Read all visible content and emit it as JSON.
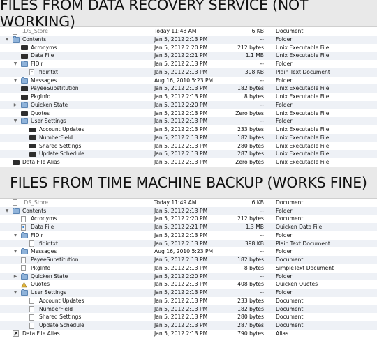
{
  "banners": {
    "top": "FILES FROM DATA RECOVERY SERVICE (NOT WORKING)",
    "bottom": "FILES FROM TIME MACHINE BACKUP (WORKS FINE)"
  },
  "panel_recovery": {
    "rows": [
      {
        "name": ".DS_Store",
        "date": "Today 11:48 AM",
        "size": "6 KB",
        "kind": "Document",
        "level": 0,
        "disclosure": "",
        "icon": "document-icon"
      },
      {
        "name": "Contents",
        "date": "Jan 5, 2012 2:13 PM",
        "size": "--",
        "kind": "Folder",
        "level": 0,
        "disclosure": "open",
        "icon": "folder-icon"
      },
      {
        "name": "Acronyms",
        "date": "Jan 5, 2012 2:20 PM",
        "size": "212 bytes",
        "kind": "Unix Executable File",
        "level": 1,
        "disclosure": "",
        "icon": "executable-icon"
      },
      {
        "name": "Data File",
        "date": "Jan 5, 2012 2:21 PM",
        "size": "1.1 MB",
        "kind": "Unix Executable File",
        "level": 1,
        "disclosure": "",
        "icon": "executable-icon"
      },
      {
        "name": "FIDir",
        "date": "Jan 5, 2012 2:13 PM",
        "size": "--",
        "kind": "Folder",
        "level": 1,
        "disclosure": "open",
        "icon": "folder-icon"
      },
      {
        "name": "fidir.txt",
        "date": "Jan 5, 2012 2:13 PM",
        "size": "398 KB",
        "kind": "Plain Text Document",
        "level": 2,
        "disclosure": "",
        "icon": "text-document-icon"
      },
      {
        "name": "Messages",
        "date": "Aug 16, 2010 5:23 PM",
        "size": "--",
        "kind": "Folder",
        "level": 1,
        "disclosure": "open",
        "icon": "folder-icon"
      },
      {
        "name": "PayeeSubstitution",
        "date": "Jan 5, 2012 2:13 PM",
        "size": "182 bytes",
        "kind": "Unix Executable File",
        "level": 1,
        "disclosure": "",
        "icon": "executable-icon"
      },
      {
        "name": "PkgInfo",
        "date": "Jan 5, 2012 2:13 PM",
        "size": "8 bytes",
        "kind": "Unix Executable File",
        "level": 1,
        "disclosure": "",
        "icon": "executable-icon"
      },
      {
        "name": "Quicken State",
        "date": "Jan 5, 2012 2:20 PM",
        "size": "--",
        "kind": "Folder",
        "level": 1,
        "disclosure": "closed",
        "icon": "folder-icon"
      },
      {
        "name": "Quotes",
        "date": "Jan 5, 2012 2:13 PM",
        "size": "Zero bytes",
        "kind": "Unix Executable File",
        "level": 1,
        "disclosure": "",
        "icon": "executable-icon"
      },
      {
        "name": "User Settings",
        "date": "Jan 5, 2012 2:13 PM",
        "size": "--",
        "kind": "Folder",
        "level": 1,
        "disclosure": "open",
        "icon": "folder-icon"
      },
      {
        "name": "Account Updates",
        "date": "Jan 5, 2012 2:13 PM",
        "size": "233 bytes",
        "kind": "Unix Executable File",
        "level": 2,
        "disclosure": "",
        "icon": "executable-icon"
      },
      {
        "name": "NumberField",
        "date": "Jan 5, 2012 2:13 PM",
        "size": "182 bytes",
        "kind": "Unix Executable File",
        "level": 2,
        "disclosure": "",
        "icon": "executable-icon"
      },
      {
        "name": "Shared Settings",
        "date": "Jan 5, 2012 2:13 PM",
        "size": "280 bytes",
        "kind": "Unix Executable File",
        "level": 2,
        "disclosure": "",
        "icon": "executable-icon"
      },
      {
        "name": "Update Schedule",
        "date": "Jan 5, 2012 2:13 PM",
        "size": "287 bytes",
        "kind": "Unix Executable File",
        "level": 2,
        "disclosure": "",
        "icon": "executable-icon"
      },
      {
        "name": "Data File Alias",
        "date": "Jan 5, 2012 2:13 PM",
        "size": "Zero bytes",
        "kind": "Unix Executable File",
        "level": 0,
        "disclosure": "",
        "icon": "executable-icon"
      }
    ]
  },
  "panel_timemachine": {
    "rows": [
      {
        "name": ".DS_Store",
        "date": "Today 11:49 AM",
        "size": "6 KB",
        "kind": "Document",
        "level": 0,
        "disclosure": "",
        "icon": "document-icon"
      },
      {
        "name": "Contents",
        "date": "Jan 5, 2012 2:13 PM",
        "size": "--",
        "kind": "Folder",
        "level": 0,
        "disclosure": "open",
        "icon": "folder-icon"
      },
      {
        "name": "Acronyms",
        "date": "Jan 5, 2012 2:20 PM",
        "size": "212 bytes",
        "kind": "Document",
        "level": 1,
        "disclosure": "",
        "icon": "document-icon"
      },
      {
        "name": "Data File",
        "date": "Jan 5, 2012 2:21 PM",
        "size": "1.3 MB",
        "kind": "Quicken Data File",
        "level": 1,
        "disclosure": "",
        "icon": "quicken-document-icon"
      },
      {
        "name": "FIDir",
        "date": "Jan 5, 2012 2:13 PM",
        "size": "--",
        "kind": "Folder",
        "level": 1,
        "disclosure": "open",
        "icon": "folder-icon"
      },
      {
        "name": "fidir.txt",
        "date": "Jan 5, 2012 2:13 PM",
        "size": "398 KB",
        "kind": "Plain Text Document",
        "level": 2,
        "disclosure": "",
        "icon": "text-document-icon"
      },
      {
        "name": "Messages",
        "date": "Aug 16, 2010 5:23 PM",
        "size": "--",
        "kind": "Folder",
        "level": 1,
        "disclosure": "open",
        "icon": "folder-icon"
      },
      {
        "name": "PayeeSubstitution",
        "date": "Jan 5, 2012 2:13 PM",
        "size": "182 bytes",
        "kind": "Document",
        "level": 1,
        "disclosure": "",
        "icon": "document-icon"
      },
      {
        "name": "PkgInfo",
        "date": "Jan 5, 2012 2:13 PM",
        "size": "8 bytes",
        "kind": "SimpleText Document",
        "level": 1,
        "disclosure": "",
        "icon": "document-icon"
      },
      {
        "name": "Quicken State",
        "date": "Jan 5, 2012 2:20 PM",
        "size": "--",
        "kind": "Folder",
        "level": 1,
        "disclosure": "closed",
        "icon": "folder-icon"
      },
      {
        "name": "Quotes",
        "date": "Jan 5, 2012 2:13 PM",
        "size": "408 bytes",
        "kind": "Quicken Quotes",
        "level": 1,
        "disclosure": "",
        "icon": "quotes-icon"
      },
      {
        "name": "User Settings",
        "date": "Jan 5, 2012 2:13 PM",
        "size": "--",
        "kind": "Folder",
        "level": 1,
        "disclosure": "open",
        "icon": "folder-icon"
      },
      {
        "name": "Account Updates",
        "date": "Jan 5, 2012 2:13 PM",
        "size": "233 bytes",
        "kind": "Document",
        "level": 2,
        "disclosure": "",
        "icon": "document-icon"
      },
      {
        "name": "NumberField",
        "date": "Jan 5, 2012 2:13 PM",
        "size": "182 bytes",
        "kind": "Document",
        "level": 2,
        "disclosure": "",
        "icon": "document-icon"
      },
      {
        "name": "Shared Settings",
        "date": "Jan 5, 2012 2:13 PM",
        "size": "280 bytes",
        "kind": "Document",
        "level": 2,
        "disclosure": "",
        "icon": "document-icon"
      },
      {
        "name": "Update Schedule",
        "date": "Jan 5, 2012 2:13 PM",
        "size": "287 bytes",
        "kind": "Document",
        "level": 2,
        "disclosure": "",
        "icon": "document-icon"
      },
      {
        "name": "Data File Alias",
        "date": "Jan 5, 2012 2:13 PM",
        "size": "790 bytes",
        "kind": "Alias",
        "level": 0,
        "disclosure": "",
        "icon": "alias-icon"
      }
    ]
  }
}
